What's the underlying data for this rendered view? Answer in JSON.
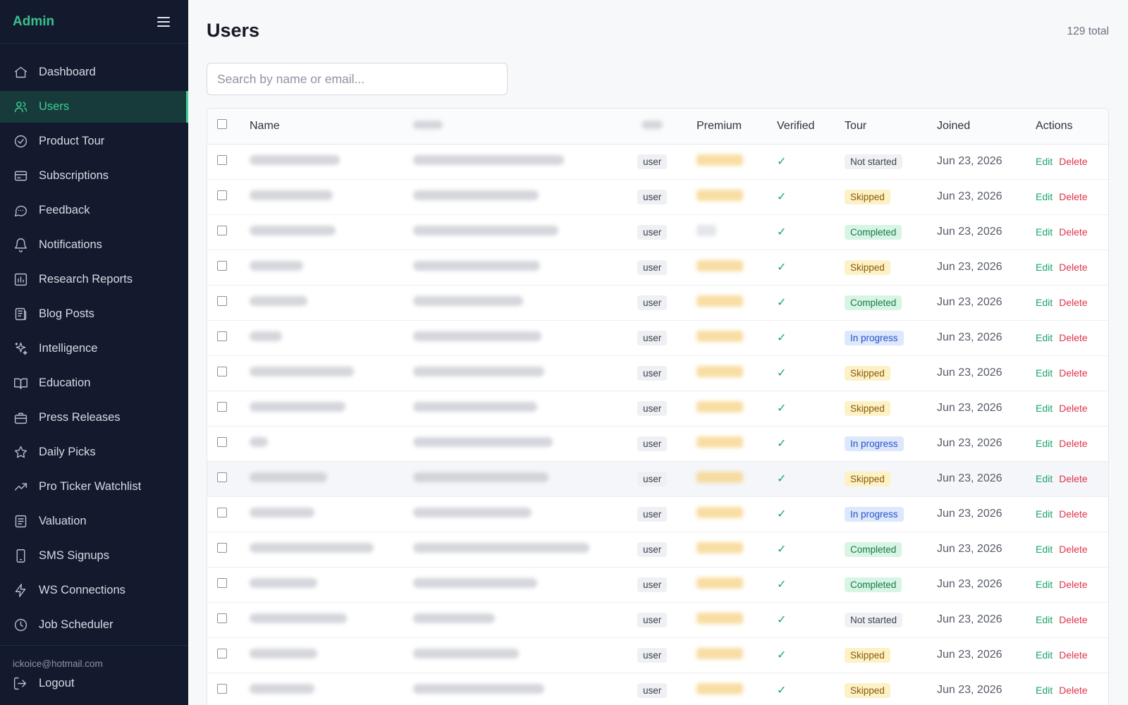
{
  "sidebar": {
    "brand": "Admin",
    "items": [
      {
        "label": "Dashboard",
        "icon": "home-icon",
        "active": false
      },
      {
        "label": "Users",
        "icon": "users-icon",
        "active": true
      },
      {
        "label": "Product Tour",
        "icon": "check-circle-icon",
        "active": false
      },
      {
        "label": "Subscriptions",
        "icon": "credit-card-icon",
        "active": false
      },
      {
        "label": "Feedback",
        "icon": "message-circle-icon",
        "active": false
      },
      {
        "label": "Notifications",
        "icon": "bell-icon",
        "active": false
      },
      {
        "label": "Research Reports",
        "icon": "bar-chart-icon",
        "active": false
      },
      {
        "label": "Blog Posts",
        "icon": "newspaper-icon",
        "active": false
      },
      {
        "label": "Intelligence",
        "icon": "sparkles-icon",
        "active": false
      },
      {
        "label": "Education",
        "icon": "book-open-icon",
        "active": false
      },
      {
        "label": "Press Releases",
        "icon": "briefcase-icon",
        "active": false
      },
      {
        "label": "Daily Picks",
        "icon": "star-icon",
        "active": false
      },
      {
        "label": "Pro Ticker Watchlist",
        "icon": "trending-up-icon",
        "active": false
      },
      {
        "label": "Valuation",
        "icon": "file-text-icon",
        "active": false
      },
      {
        "label": "SMS Signups",
        "icon": "smartphone-icon",
        "active": false
      },
      {
        "label": "WS Connections",
        "icon": "zap-icon",
        "active": false
      },
      {
        "label": "Job Scheduler",
        "icon": "clock-icon",
        "active": false
      }
    ],
    "user_email": "ickoice@hotmail.com",
    "logout_label": "Logout"
  },
  "header": {
    "title": "Users",
    "total": "129 total"
  },
  "search": {
    "placeholder": "Search by name or email...",
    "value": ""
  },
  "table": {
    "columns": [
      "",
      "Name",
      "",
      "",
      "Premium",
      "Verified",
      "Tour",
      "Joined",
      "Actions"
    ],
    "rows": [
      {
        "role": "user",
        "premium": true,
        "verified": "✓",
        "tour": "Not started",
        "tour_status": "not-started",
        "joined": "Jun 23, 2026"
      },
      {
        "role": "user",
        "premium": true,
        "verified": "✓",
        "tour": "Skipped",
        "tour_status": "skipped",
        "joined": "Jun 23, 2026"
      },
      {
        "role": "user",
        "premium": false,
        "verified": "✓",
        "tour": "Completed",
        "tour_status": "completed",
        "joined": "Jun 23, 2026"
      },
      {
        "role": "user",
        "premium": true,
        "verified": "✓",
        "tour": "Skipped",
        "tour_status": "skipped",
        "joined": "Jun 23, 2026"
      },
      {
        "role": "user",
        "premium": true,
        "verified": "✓",
        "tour": "Completed",
        "tour_status": "completed",
        "joined": "Jun 23, 2026"
      },
      {
        "role": "user",
        "premium": true,
        "verified": "✓",
        "tour": "In progress",
        "tour_status": "in-progress",
        "joined": "Jun 23, 2026"
      },
      {
        "role": "user",
        "premium": true,
        "verified": "✓",
        "tour": "Skipped",
        "tour_status": "skipped",
        "joined": "Jun 23, 2026"
      },
      {
        "role": "user",
        "premium": true,
        "verified": "✓",
        "tour": "Skipped",
        "tour_status": "skipped",
        "joined": "Jun 23, 2026"
      },
      {
        "role": "user",
        "premium": true,
        "verified": "✓",
        "tour": "In progress",
        "tour_status": "in-progress",
        "joined": "Jun 23, 2026"
      },
      {
        "role": "user",
        "premium": true,
        "verified": "✓",
        "tour": "Skipped",
        "tour_status": "skipped",
        "joined": "Jun 23, 2026",
        "highlighted": true
      },
      {
        "role": "user",
        "premium": true,
        "verified": "✓",
        "tour": "In progress",
        "tour_status": "in-progress",
        "joined": "Jun 23, 2026"
      },
      {
        "role": "user",
        "premium": true,
        "verified": "✓",
        "tour": "Completed",
        "tour_status": "completed",
        "joined": "Jun 23, 2026"
      },
      {
        "role": "user",
        "premium": true,
        "verified": "✓",
        "tour": "Completed",
        "tour_status": "completed",
        "joined": "Jun 23, 2026"
      },
      {
        "role": "user",
        "premium": true,
        "verified": "✓",
        "tour": "Not started",
        "tour_status": "not-started",
        "joined": "Jun 23, 2026"
      },
      {
        "role": "user",
        "premium": true,
        "verified": "✓",
        "tour": "Skipped",
        "tour_status": "skipped",
        "joined": "Jun 23, 2026"
      },
      {
        "role": "user",
        "premium": true,
        "verified": "✓",
        "tour": "Skipped",
        "tour_status": "skipped",
        "joined": "Jun 23, 2026"
      }
    ],
    "actions": {
      "edit": "Edit",
      "delete": "Delete"
    }
  },
  "colors": {
    "sidebar_bg": "#131a2e",
    "accent": "#3fcf94",
    "delete": "#e0334a",
    "tour_skipped_bg": "#fdf1c6",
    "tour_completed_bg": "#d8f5e4",
    "tour_in_progress_bg": "#dde8fd",
    "tour_not_started_bg": "#f0f1f4"
  }
}
